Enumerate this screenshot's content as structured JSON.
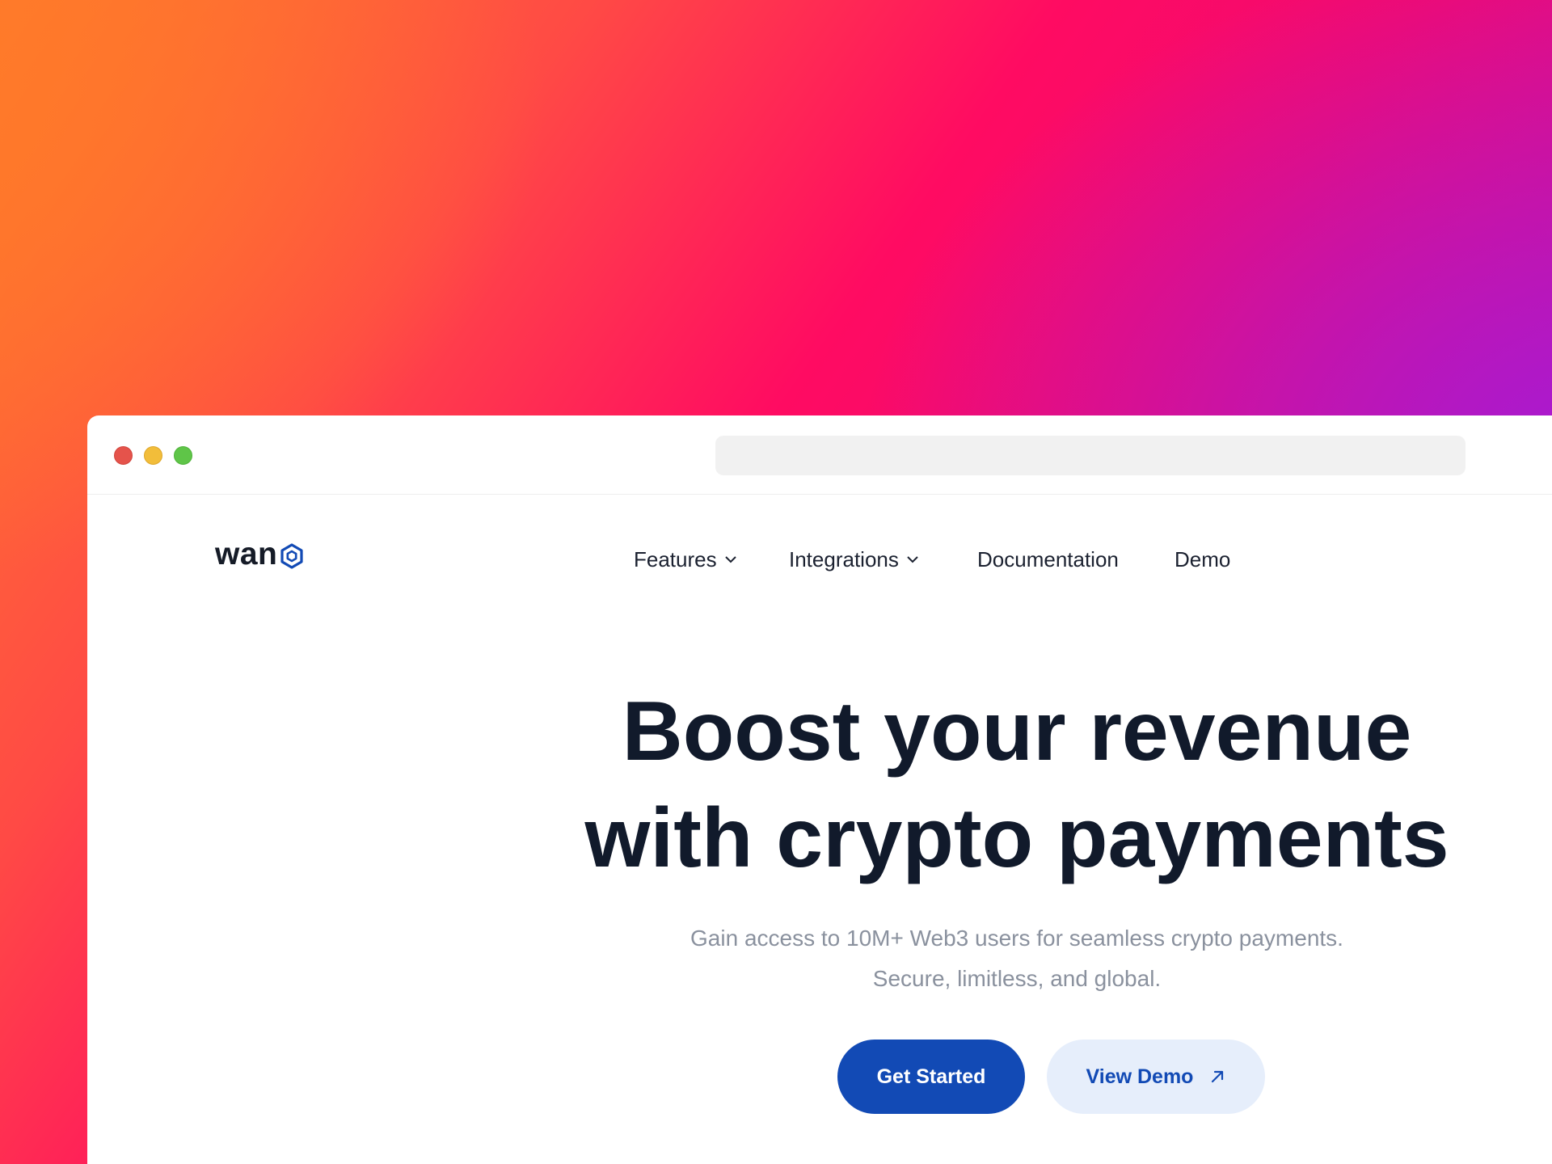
{
  "window": {
    "controls": [
      "close",
      "minimize",
      "maximize"
    ],
    "address_bar": ""
  },
  "brand": {
    "name": "wan",
    "logo_icon": "hexagon-icon",
    "accent_color": "#124ab5"
  },
  "nav": {
    "items": [
      {
        "label": "Features",
        "has_dropdown": true
      },
      {
        "label": "Integrations",
        "has_dropdown": true
      },
      {
        "label": "Documentation",
        "has_dropdown": false
      },
      {
        "label": "Demo",
        "has_dropdown": false
      }
    ]
  },
  "hero": {
    "title_line1": "Boost your revenue",
    "title_line2": "with crypto payments",
    "subtitle_line1": "Gain access to 10M+ Web3 users for seamless crypto payments.",
    "subtitle_line2": "Secure, limitless, and global.",
    "primary_cta": "Get Started",
    "secondary_cta": "View Demo",
    "secondary_cta_icon": "arrow-up-right-icon"
  },
  "colors": {
    "title": "#111a2b",
    "subtitle": "#8a919e",
    "primary_button_bg": "#124ab5",
    "secondary_button_bg": "#e6eefb"
  }
}
